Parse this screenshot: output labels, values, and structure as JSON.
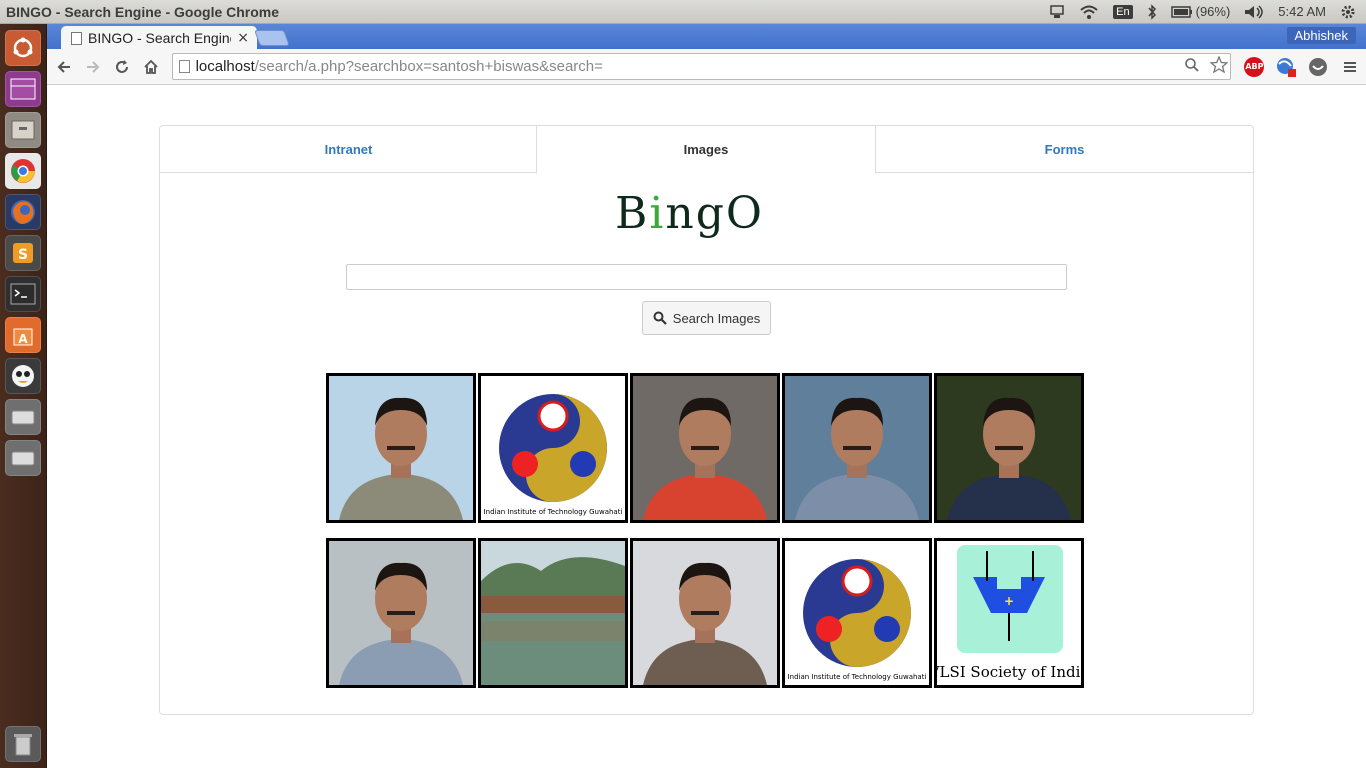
{
  "window": {
    "title": "BINGO - Search Engine - Google Chrome"
  },
  "tray": {
    "keyboard": "En",
    "battery": "(96%)",
    "time": "5:42 AM"
  },
  "browser": {
    "tab_title": "BINGO - Search Engine",
    "tab_close": "×",
    "user": "Abhishek",
    "url_host": "localhost",
    "url_path": "/search/a.php?searchbox=santosh+biswas&search=",
    "abp_label": "ABP"
  },
  "page": {
    "tabs": [
      {
        "label": "Intranet",
        "active": false
      },
      {
        "label": "Images",
        "active": true
      },
      {
        "label": "Forms",
        "active": false
      }
    ],
    "logo": {
      "b": "B",
      "i": "i",
      "ngo": "ngO"
    },
    "search_input": {
      "value": "",
      "placeholder": ""
    },
    "search_button": "Search Images",
    "results": [
      {
        "kind": "portrait",
        "bg": "#b9d4e6",
        "shirt": "#8c8a78"
      },
      {
        "kind": "iitg-logo",
        "caption": "Indian Institute of Technology Guwahati"
      },
      {
        "kind": "portrait",
        "bg": "#6f6a66",
        "shirt": "#d8432f"
      },
      {
        "kind": "portrait",
        "bg": "#5f7f9a",
        "shirt": "#7d8fa8"
      },
      {
        "kind": "portrait",
        "bg": "#2e3a20",
        "shirt": "#25304a"
      },
      {
        "kind": "portrait",
        "bg": "#b8c0c4",
        "shirt": "#8a9db3"
      },
      {
        "kind": "landscape"
      },
      {
        "kind": "portrait",
        "bg": "#d7d9dd",
        "shirt": "#6e5e52"
      },
      {
        "kind": "iitg-logo",
        "caption": "Indian Institute of Technology Guwahati"
      },
      {
        "kind": "vlsi-logo",
        "caption": "VLSI Society of India"
      }
    ]
  }
}
